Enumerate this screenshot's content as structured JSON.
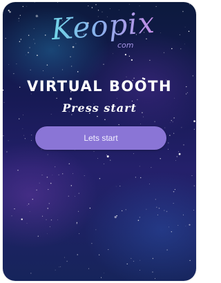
{
  "logo": {
    "main": "Keopix",
    "sub": "com"
  },
  "booth": {
    "title": "VIRTUAL BOOTH",
    "subtitle": "Press start",
    "start_button_label": "Lets start"
  },
  "colors": {
    "button": "#8a75d6",
    "text": "#ffffff",
    "logo_start": "#6fd4e6",
    "logo_end": "#c38ce6"
  }
}
